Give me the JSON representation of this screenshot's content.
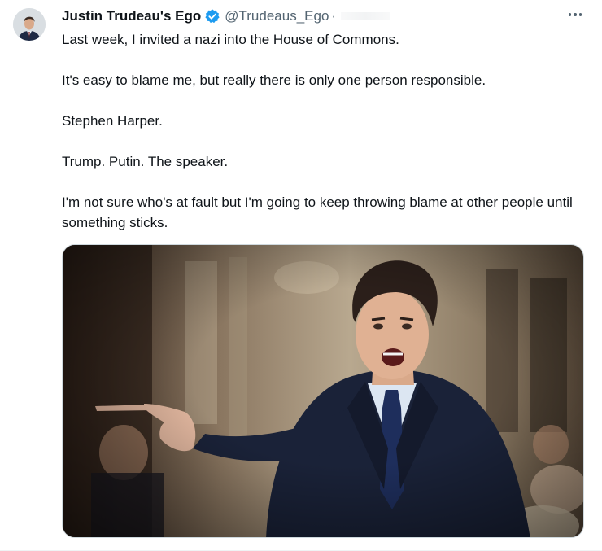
{
  "tweet": {
    "display_name": "Justin Trudeau's Ego",
    "handle": "@Trudeaus_Ego",
    "separator": "·",
    "verified": true,
    "more_icon": "ellipsis-icon",
    "paragraphs": [
      "Last week, I invited a nazi into the House of Commons.",
      "It's easy to blame me, but really there is only one person responsible.",
      "Stephen Harper.",
      "Trump. Putin. The speaker.",
      "I'm not sure who's at fault but I'm going to keep throwing blame at other people until something sticks."
    ]
  },
  "colors": {
    "text": "#0f1419",
    "secondary": "#536471",
    "verified_blue": "#1d9bf0",
    "border": "#cfd9de"
  }
}
